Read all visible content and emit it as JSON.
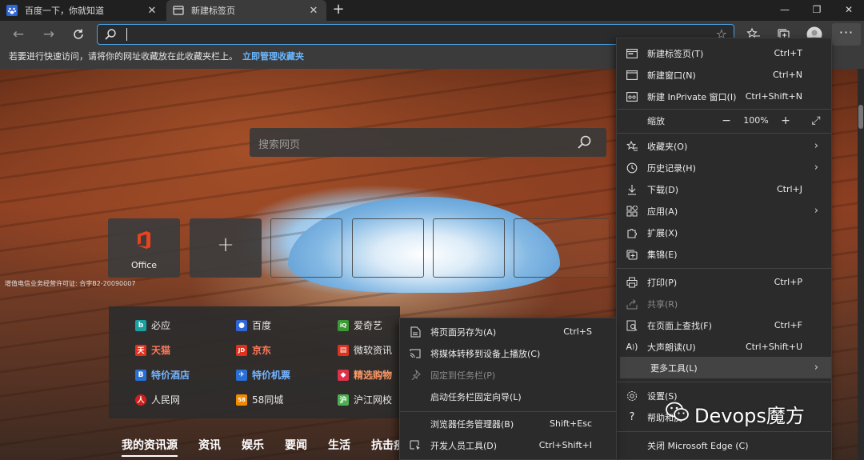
{
  "tabs": [
    {
      "title": "百度一下，你就知道",
      "icon": "baidu-paw-icon",
      "active": false
    },
    {
      "title": "新建标签页",
      "icon": "newtab-page-icon",
      "active": true
    }
  ],
  "window_controls": [
    "minimize",
    "maximize",
    "close"
  ],
  "address_bar": {
    "value": "",
    "placeholder": ""
  },
  "favorites_hint": {
    "text": "若要进行快速访问，请将你的网址收藏放在此收藏夹栏上。",
    "link": "立即管理收藏夹"
  },
  "new_tab_page": {
    "search_placeholder": "搜索网页",
    "tiles": [
      {
        "label": "Office"
      },
      {
        "label": "+"
      }
    ],
    "icp": "增值电信业务经营许可证: 合字B2-20090007",
    "quick_links": [
      {
        "label": "必应",
        "style": "normal",
        "color": "#1aa0a0"
      },
      {
        "label": "百度",
        "style": "normal",
        "color": "#2f66d8"
      },
      {
        "label": "爱奇艺",
        "style": "normal",
        "color": "#3c9a34"
      },
      {
        "label": "天猫",
        "style": "red",
        "color": "#e0301e"
      },
      {
        "label": "京东",
        "style": "red",
        "color": "#e0301e"
      },
      {
        "label": "微软资讯",
        "style": "normal",
        "color": "#e0301e"
      },
      {
        "label": "特价酒店",
        "style": "blue",
        "color": "#2a6fd6"
      },
      {
        "label": "特价机票",
        "style": "blue",
        "color": "#2a6fd6"
      },
      {
        "label": "精选购物",
        "style": "orange",
        "color": "#e0304a"
      },
      {
        "label": "人民网",
        "style": "normal",
        "color": "#d0201e"
      },
      {
        "label": "58同城",
        "style": "normal",
        "color": "#f08a00"
      },
      {
        "label": "沪江网校",
        "style": "normal",
        "color": "#4caf50"
      }
    ],
    "feed_tabs": [
      "我的资讯源",
      "资讯",
      "娱乐",
      "要闻",
      "生活",
      "抗击疫"
    ]
  },
  "menu": {
    "items_top": [
      {
        "label": "新建标签页(T)",
        "shortcut": "Ctrl+T",
        "icon": "new-tab-icon"
      },
      {
        "label": "新建窗口(N)",
        "shortcut": "Ctrl+N",
        "icon": "new-window-icon"
      },
      {
        "label": "新建 InPrivate 窗口(I)",
        "shortcut": "Ctrl+Shift+N",
        "icon": "inprivate-icon"
      }
    ],
    "zoom": {
      "label": "缩放",
      "minus": "−",
      "value": "100%",
      "plus": "+"
    },
    "items_mid": [
      {
        "label": "收藏夹(O)",
        "shortcut": "",
        "icon": "favorites-icon",
        "submenu": true
      },
      {
        "label": "历史记录(H)",
        "shortcut": "",
        "icon": "history-icon",
        "submenu": true
      },
      {
        "label": "下载(D)",
        "shortcut": "Ctrl+J",
        "icon": "download-icon"
      },
      {
        "label": "应用(A)",
        "shortcut": "",
        "icon": "apps-icon",
        "submenu": true
      },
      {
        "label": "扩展(X)",
        "shortcut": "",
        "icon": "extensions-icon"
      },
      {
        "label": "集锦(E)",
        "shortcut": "",
        "icon": "collections-icon"
      }
    ],
    "items_tools": [
      {
        "label": "打印(P)",
        "shortcut": "Ctrl+P",
        "icon": "print-icon"
      },
      {
        "label": "共享(R)",
        "shortcut": "",
        "icon": "share-icon",
        "disabled": true
      },
      {
        "label": "在页面上查找(F)",
        "shortcut": "Ctrl+F",
        "icon": "find-icon"
      },
      {
        "label": "大声朗读(U)",
        "shortcut": "Ctrl+Shift+U",
        "icon": "read-aloud-icon"
      },
      {
        "label": "更多工具(L)",
        "shortcut": "",
        "icon": "",
        "submenu": true,
        "highlight": true
      }
    ],
    "items_bottom": [
      {
        "label": "设置(S)",
        "shortcut": "",
        "icon": "settings-icon"
      },
      {
        "label": "帮助和反",
        "shortcut": "",
        "icon": "help-icon"
      },
      {
        "label": "关闭 Microsoft Edge (C)",
        "shortcut": "",
        "icon": ""
      }
    ]
  },
  "more_tools_submenu": [
    {
      "label": "将页面另存为(A)",
      "shortcut": "Ctrl+S",
      "icon": "save-page-icon"
    },
    {
      "label": "将媒体转移到设备上播放(C)",
      "shortcut": "",
      "icon": "cast-icon"
    },
    {
      "label": "固定到任务栏(P)",
      "shortcut": "",
      "icon": "pin-icon",
      "disabled": true
    },
    {
      "label": "启动任务栏固定向导(L)",
      "shortcut": "",
      "icon": ""
    },
    {
      "label": "浏览器任务管理器(B)",
      "shortcut": "Shift+Esc",
      "icon": ""
    },
    {
      "label": "开发人员工具(D)",
      "shortcut": "Ctrl+Shift+I",
      "icon": "devtools-icon"
    }
  ],
  "watermark": {
    "text": "Devops魔方",
    "icon": "wechat-icon"
  },
  "colors": {
    "accent": "#4aa3e8",
    "link": "#6ab7ff",
    "menu_bg": "#2b2b2b",
    "menu_highlight": "#434343"
  }
}
